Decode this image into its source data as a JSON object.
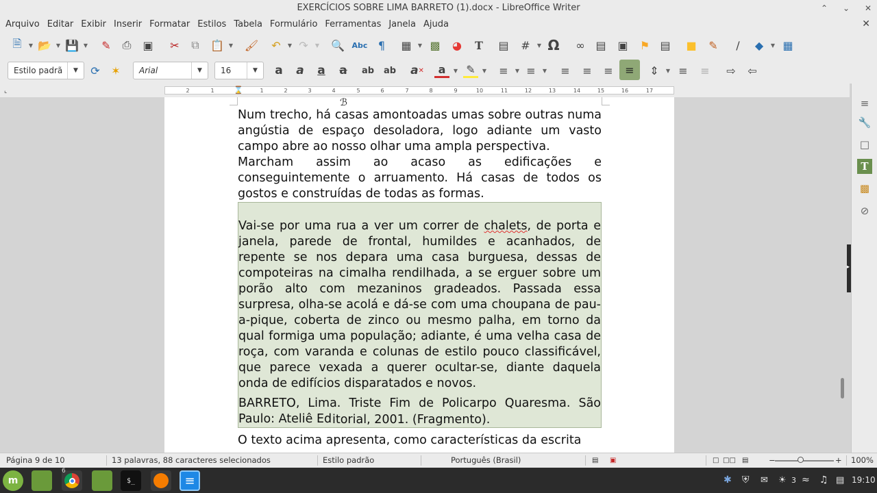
{
  "window": {
    "title": "EXERCÍCIOS SOBRE LIMA BARRETO (1).docx - LibreOffice Writer",
    "controls": [
      "minimize-icon",
      "maximize-icon",
      "close-icon"
    ]
  },
  "menu": [
    "Arquivo",
    "Editar",
    "Exibir",
    "Inserir",
    "Formatar",
    "Estilos",
    "Tabela",
    "Formulário",
    "Ferramentas",
    "Janela",
    "Ajuda"
  ],
  "formatting": {
    "paragraph_style": "Estilo padrã",
    "font_name": "Arial",
    "font_size": "16"
  },
  "ruler": {
    "ticks": [
      "2",
      "1",
      "1",
      "2",
      "3",
      "4",
      "5",
      "6",
      "7",
      "8",
      "9",
      "10",
      "11",
      "12",
      "13",
      "14",
      "15",
      "16",
      "17"
    ]
  },
  "document": {
    "p1": "Num trecho, há casas amontoadas umas sobre outras numa angústia de espaço desoladora, logo adiante um vasto campo abre ao nosso olhar uma ampla perspectiva.",
    "p2": "Marcham assim ao acaso as edificações e conseguintemente o arruamento. Há casas de todos os gostos e construídas de todas as formas.",
    "p3_before": "Vai-se por uma rua a ver um correr de ",
    "p3_squiggle": "chalets",
    "p3_after": ", de porta e janela, parede de frontal, humildes e acanhados, de repente se nos depara uma casa burguesa, dessas de compoteiras na cimalha rendilhada, a se erguer sobre um porão alto com mezaninos gradeados. Passada essa surpresa, olha-se acolá e dá-se com uma choupana de pau-a-pique, coberta de zinco ou mesmo palha, em torno da qual formiga uma população; adiante, é uma velha casa de roça, com varanda e colunas de estilo pouco classificável, que parece vexada a querer ocultar-se, diante daquela onda de edifícios disparatados e novos.",
    "citation_selected": "BARRETO, Lima. Triste Fim de Policarpo Quaresma. São Paulo: Ateliê Ed",
    "citation_rest": "itorial, 2001. (Fragmento).",
    "p5": "O texto acima apresenta, como características da escrita"
  },
  "status": {
    "page": "Página 9 de 10",
    "words": "13 palavras, 88 caracteres selecionados",
    "style": "Estilo padrão",
    "language": "Português (Brasil)",
    "zoom": "100%"
  },
  "taskbar": {
    "apps": [
      "mint-menu-icon",
      "show-desktop-icon",
      "chrome-icon",
      "files-icon",
      "terminal-icon",
      "firefox-icon",
      "writer-icon"
    ],
    "chrome_badge": "6",
    "notif_count": "3",
    "clock": "19:10"
  },
  "colors": {
    "selection": "#dfe7d6",
    "active_button": "#8fa876",
    "taskbar": "#2b2b2b",
    "mint_green": "#7cb342"
  }
}
